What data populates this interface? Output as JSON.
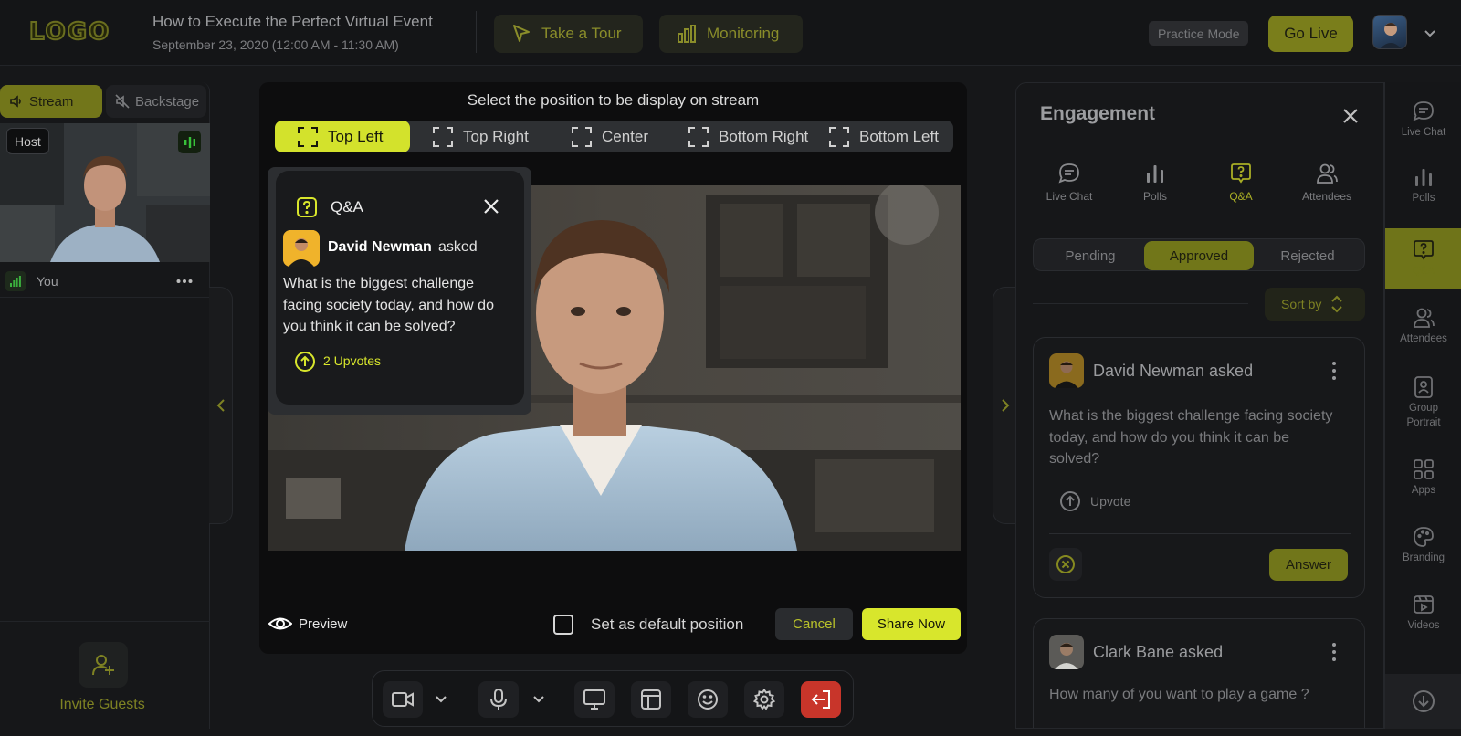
{
  "header": {
    "logo": "LOGO",
    "event_title": "How to Execute the Perfect Virtual Event",
    "event_date": "September 23, 2020 (12:00 AM - 11:30 AM)",
    "take_tour": "Take a Tour",
    "monitoring": "Monitoring",
    "practice_mode": "Practice Mode",
    "go_live": "Go Live"
  },
  "left_panel": {
    "tab_stream": "Stream",
    "tab_backstage": "Backstage",
    "host_badge": "Host",
    "you_label": "You",
    "invite_label": "Invite Guests"
  },
  "modal": {
    "title": "Select the position to be display on stream",
    "positions": [
      {
        "label": "Top Left",
        "active": true
      },
      {
        "label": "Top Right",
        "active": false
      },
      {
        "label": "Center",
        "active": false
      },
      {
        "label": "Bottom Right",
        "active": false
      },
      {
        "label": "Bottom Left",
        "active": false
      }
    ],
    "qa_card": {
      "title": "Q&A",
      "asker": "David Newman",
      "asked_suffix": "asked",
      "question": "What is the biggest challenge facing society today, and how do you think it can be solved?",
      "upvotes": "2 Upvotes"
    },
    "preview_label": "Preview",
    "default_position_label": "Set as default position",
    "default_position_checked": false,
    "cancel": "Cancel",
    "share_now": "Share Now"
  },
  "engagement": {
    "title": "Engagement",
    "tabs": [
      "Live Chat",
      "Polls",
      "Q&A",
      "Attendees"
    ],
    "active_tab": "Q&A",
    "status_tabs": [
      "Pending",
      "Approved",
      "Rejected"
    ],
    "active_status": "Approved",
    "sort_by": "Sort by",
    "questions": [
      {
        "asker": "David Newman asked",
        "text": "What is the biggest challenge facing society today, and how do you think it can be solved?",
        "upvote_label": "Upvote",
        "answer_label": "Answer"
      },
      {
        "asker": "Clark Bane asked",
        "text": "How many of you want to play a game ?"
      }
    ]
  },
  "rail": {
    "items": [
      "Live Chat",
      "Polls",
      "Q&A",
      "Attendees",
      "Group Portrait",
      "Apps",
      "Branding",
      "Videos"
    ],
    "active": "Q&A"
  },
  "colors": {
    "accent": "#d8e62c",
    "accent_dim": "#72761a",
    "leave": "#c8352a",
    "background": "#161719"
  }
}
